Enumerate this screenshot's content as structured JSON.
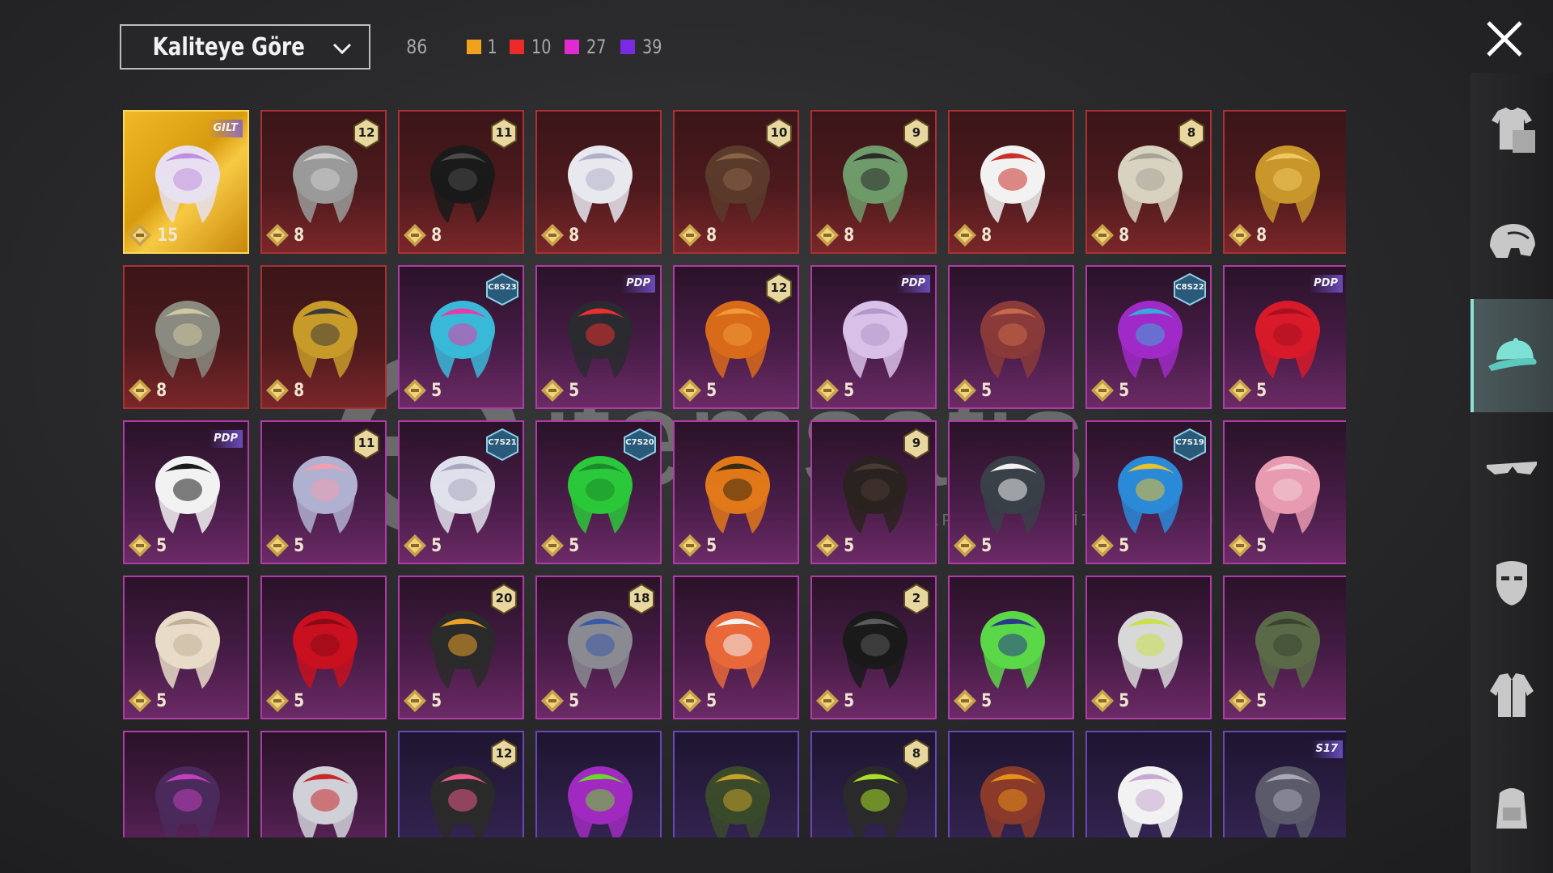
{
  "sort": {
    "label": "Kaliteye Göre"
  },
  "stats": {
    "total": "86",
    "counts": [
      {
        "color": "#f0a21e",
        "value": "1"
      },
      {
        "color": "#ec2a2a",
        "value": "10"
      },
      {
        "color": "#e22ad2",
        "value": "27"
      },
      {
        "color": "#7a2ae2",
        "value": "39"
      }
    ]
  },
  "side_categories": [
    {
      "name": "outfits",
      "icon": "shirt-icon",
      "active": false
    },
    {
      "name": "helmets",
      "icon": "helmet-icon",
      "active": false
    },
    {
      "name": "hats",
      "icon": "cap-icon",
      "active": true
    },
    {
      "name": "eyewear",
      "icon": "glasses-icon",
      "active": false
    },
    {
      "name": "masks",
      "icon": "mask-icon",
      "active": false
    },
    {
      "name": "jackets",
      "icon": "jacket-icon",
      "active": false
    },
    {
      "name": "backpacks",
      "icon": "backpack-icon",
      "active": false
    }
  ],
  "items": [
    {
      "quality": "gold",
      "icon": "tiara-hat-icon",
      "points": "15",
      "tag": "GILT"
    },
    {
      "quality": "red",
      "icon": "grey-wig-icon",
      "points": "8",
      "level": "12"
    },
    {
      "quality": "red",
      "icon": "black-hair-icon",
      "points": "8",
      "level": "11"
    },
    {
      "quality": "red",
      "icon": "white-hood-icon",
      "points": "8"
    },
    {
      "quality": "red",
      "icon": "brown-hair-icon",
      "points": "8",
      "level": "10"
    },
    {
      "quality": "red",
      "icon": "zombie-head-icon",
      "points": "8",
      "level": "9"
    },
    {
      "quality": "red",
      "icon": "white-cowboy-hat-icon",
      "points": "8"
    },
    {
      "quality": "red",
      "icon": "silver-hair-icon",
      "points": "8",
      "level": "8"
    },
    {
      "quality": "red",
      "icon": "golden-head-icon",
      "points": "8"
    },
    {
      "quality": "red",
      "icon": "anubis-helmet-icon",
      "points": "8"
    },
    {
      "quality": "red",
      "icon": "pharaoh-headdress-icon",
      "points": "8"
    },
    {
      "quality": "pink",
      "icon": "cat-headphones-icon",
      "points": "5",
      "rank": "C8S23"
    },
    {
      "quality": "pink",
      "icon": "sporty-cap-icon",
      "points": "5",
      "tag": "PDP"
    },
    {
      "quality": "pink",
      "icon": "orange-hair-icon",
      "points": "5",
      "level": "12"
    },
    {
      "quality": "pink",
      "icon": "lilac-hair-icon",
      "points": "5",
      "tag": "PDP"
    },
    {
      "quality": "pink",
      "icon": "auburn-hair-icon",
      "points": "5"
    },
    {
      "quality": "pink",
      "icon": "purple-hair-icon",
      "points": "5",
      "rank": "C8S22"
    },
    {
      "quality": "pink",
      "icon": "red-hair-icon",
      "points": "5",
      "tag": "PDP"
    },
    {
      "quality": "pink",
      "icon": "panda-head-icon",
      "points": "5",
      "tag": "PDP"
    },
    {
      "quality": "pink",
      "icon": "flower-wig-icon",
      "points": "5",
      "level": "11"
    },
    {
      "quality": "pink",
      "icon": "white-fur-hat-icon",
      "points": "5",
      "rank": "C7S21"
    },
    {
      "quality": "pink",
      "icon": "green-pigtails-icon",
      "points": "5",
      "rank": "C7S20"
    },
    {
      "quality": "pink",
      "icon": "pumpkin-head-icon",
      "points": "5"
    },
    {
      "quality": "pink",
      "icon": "dark-long-hair-icon",
      "points": "5",
      "level": "9"
    },
    {
      "quality": "pink",
      "icon": "shark-head-icon",
      "points": "5"
    },
    {
      "quality": "pink",
      "icon": "feather-headdress-icon",
      "points": "5",
      "rank": "C7S19"
    },
    {
      "quality": "pink",
      "icon": "pink-doll-hair-icon",
      "points": "5"
    },
    {
      "quality": "pink",
      "icon": "curly-wig-icon",
      "points": "5"
    },
    {
      "quality": "pink",
      "icon": "long-red-hair-icon",
      "points": "5"
    },
    {
      "quality": "pink",
      "icon": "demon-mask-icon",
      "points": "5",
      "level": "20"
    },
    {
      "quality": "pink",
      "icon": "blue-band-wig-icon",
      "points": "5",
      "level": "18"
    },
    {
      "quality": "pink",
      "icon": "crab-hat-icon",
      "points": "5"
    },
    {
      "quality": "pink",
      "icon": "black-sequin-hair-icon",
      "points": "5",
      "level": "2"
    },
    {
      "quality": "pink",
      "icon": "frog-police-hat-icon",
      "points": "5"
    },
    {
      "quality": "pink",
      "icon": "goggles-ponytail-icon",
      "points": "5"
    },
    {
      "quality": "pink",
      "icon": "military-helmet-icon",
      "points": "5"
    },
    {
      "quality": "pink",
      "icon": "witch-hat-icon",
      "points": ""
    },
    {
      "quality": "pink",
      "icon": "chicken-hat-icon",
      "points": ""
    },
    {
      "quality": "purple",
      "icon": "bunny-helmet-icon",
      "points": "",
      "level": "12"
    },
    {
      "quality": "purple",
      "icon": "devil-horns-icon",
      "points": ""
    },
    {
      "quality": "purple",
      "icon": "officer-cap-icon",
      "points": ""
    },
    {
      "quality": "purple",
      "icon": "skull-hood-icon",
      "points": "",
      "level": "8"
    },
    {
      "quality": "purple",
      "icon": "aviator-hat-icon",
      "points": ""
    },
    {
      "quality": "purple",
      "icon": "sun-hat-icon",
      "points": ""
    },
    {
      "quality": "purple",
      "icon": "horned-helmet-icon",
      "points": "",
      "tag": "S17"
    }
  ],
  "watermark": {
    "brand": "itemsatis",
    "tagline": "HESAP / SATIŞ / İTEM / E-PIN",
    "domain": ".com"
  }
}
